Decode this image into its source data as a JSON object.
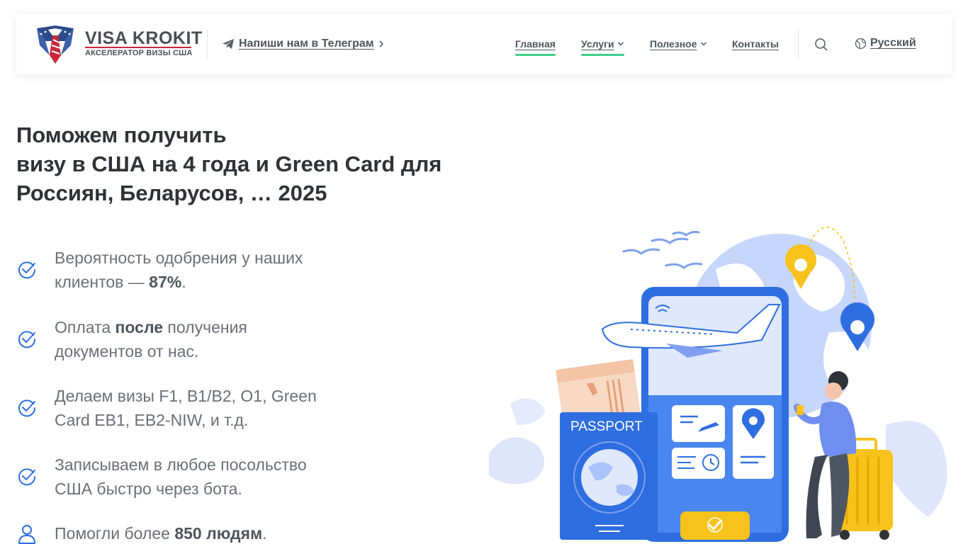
{
  "brand": {
    "name": "VISA KROKIT",
    "tagline": "АКСЕЛЕРАТОР ВИЗЫ США"
  },
  "header": {
    "telegram_label": "Напиши нам в Телеграм",
    "nav": [
      {
        "label": "Главная"
      },
      {
        "label": "Услуги"
      },
      {
        "label": "Полезное"
      },
      {
        "label": "Контакты"
      }
    ],
    "language": "Русский"
  },
  "hero": {
    "title_line1": "Поможем получить",
    "title_line2": "визу в США на 4 года и Green Card для",
    "title_line3": "Россиян, Беларусов, … 2025"
  },
  "features": [
    {
      "pre": "Вероятность одобрения у наших клиентов — ",
      "bold": "87%",
      "post": "."
    },
    {
      "pre": "Оплата ",
      "bold": "после",
      "post": " получения документов от нас."
    },
    {
      "pre": "Делаем визы F1, B1/B2, O1, Green Card EB1, EB2-NIW, и т.д.",
      "bold": "",
      "post": ""
    },
    {
      "pre": "Записываем в любое посольство США быстро через бота.",
      "bold": "",
      "post": ""
    },
    {
      "pre": "Помогли более ",
      "bold": "850 людям",
      "post": "."
    }
  ],
  "illustration": {
    "passport_label": "PASSPORT"
  },
  "colors": {
    "accent_green": "#3ecf8e",
    "accent_blue": "#2f6ee0",
    "text_dark": "#2f3236",
    "text_muted": "#6a6f77",
    "logo_red": "#c9283a",
    "pin_yellow": "#f7c21b"
  },
  "icons": [
    "telegram-icon",
    "chevron-right-icon",
    "chevron-down-icon",
    "search-icon",
    "globe-icon",
    "check-circle-icon",
    "user-icon"
  ]
}
